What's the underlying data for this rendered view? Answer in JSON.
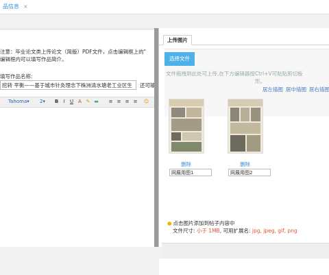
{
  "tab": {
    "label": "品信息",
    "close": "×"
  },
  "note": {
    "line1": "注意：毕业论文类上传论文（简版）PDF文件，点击编辑框上的\"",
    "line2": "编辑框内可以填写作品简介。"
  },
  "field": {
    "label": "填写作品名称:",
    "value": "挖转 平衡——基于城市针灸理念下株洲清水塘老工业区生",
    "suffix": "还可输"
  },
  "editor": {
    "font": "Tahoma",
    "size": "2",
    "buttons": [
      "B",
      "I",
      "U",
      "A",
      "✎",
      "▬",
      "≡",
      "≡",
      "≡",
      "≡",
      "☺"
    ]
  },
  "dialog": {
    "tab": "上传图片",
    "select_button": "选择文件",
    "drop_hint": "文件拖拽到此处可上传,在下方编辑器按Ctrl+V可粘贴剪切板",
    "drop_hint2": "形。",
    "insert_links": [
      "居左插图",
      "居中插图",
      "居右插图"
    ],
    "images": [
      {
        "delete": "删除",
        "caption": "网展用图1"
      },
      {
        "delete": "删除",
        "caption": "网展用图2"
      }
    ],
    "tip": "点击图片添加到帖子内容中",
    "size_prefix": "文件尺寸:",
    "size_limit": "小于 1MB",
    "ext_prefix": ", 可用扩展名:",
    "ext_list": "jpg, jpeg, gif, png"
  }
}
